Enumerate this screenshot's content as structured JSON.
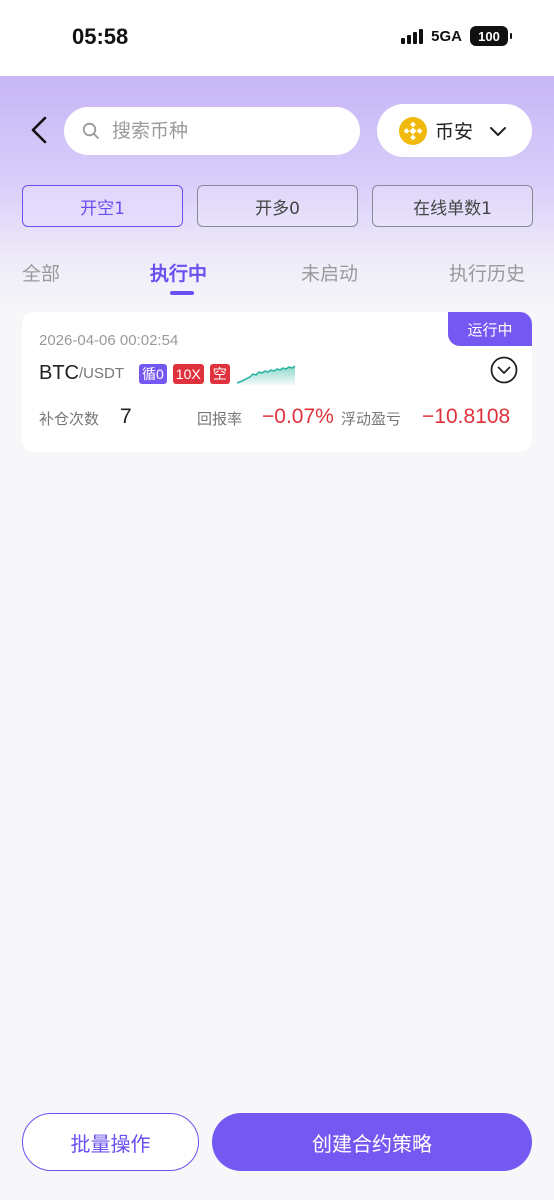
{
  "status_bar": {
    "time": "05:58",
    "network": "5GA",
    "battery": "100"
  },
  "header": {
    "search": {
      "placeholder": "搜索币种",
      "value": ""
    },
    "exchange": {
      "name": "币安"
    }
  },
  "filters": [
    {
      "label": "开空1",
      "active": true
    },
    {
      "label": "开多0",
      "active": false
    },
    {
      "label": "在线单数1",
      "active": false
    }
  ],
  "tabs": [
    {
      "label": "全部",
      "active": false
    },
    {
      "label": "执行中",
      "active": true
    },
    {
      "label": "未启动",
      "active": false
    },
    {
      "label": "执行历史",
      "active": false
    }
  ],
  "strategy_card": {
    "status": "运行中",
    "time": "2026-04-06 00:02:54",
    "pair_base": "BTC",
    "pair_quote": "/USDT",
    "tags": {
      "loop": "循0",
      "leverage": "10X",
      "direction": "空"
    },
    "stats": {
      "refill_label": "补仓次数",
      "refill_value": "7",
      "return_label": "回报率",
      "return_value": "−0.07%",
      "pnl_label": "浮动盈亏",
      "pnl_value": "−10.8108"
    }
  },
  "bottom": {
    "batch_label": "批量操作",
    "create_label": "创建合约策略"
  },
  "colors": {
    "accent": "#7558f2",
    "negative": "#e0323c",
    "exchange_brand": "#f0b90b",
    "sparkline": "#2bb6a3"
  }
}
